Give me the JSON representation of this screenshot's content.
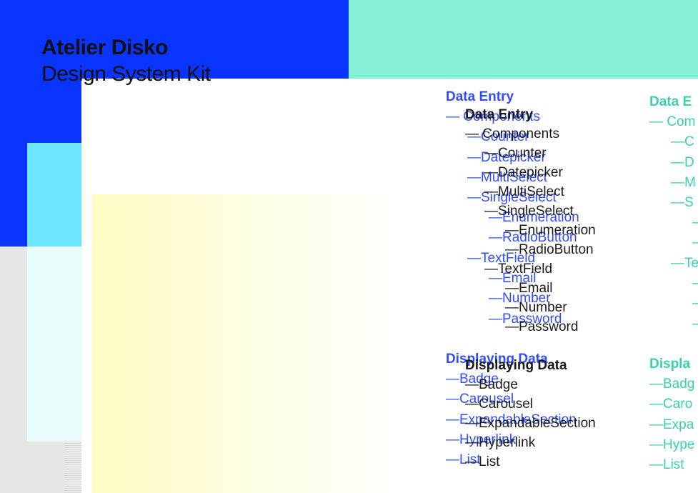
{
  "brand": {
    "title": "Atelier Disko",
    "subtitle": "Design System Kit"
  },
  "nav": {
    "data_entry": {
      "heading": "Data Entry",
      "components": "— Components",
      "counter": "—Counter",
      "datepicker": "—Datepicker",
      "multiselect": "—MultiSelect",
      "singleselect": "—SingleSelect",
      "enumeration": "—Enumeration",
      "radiobutton": "—RadioButton",
      "textfield": "—TextField",
      "email": "—Email",
      "number": "—Number",
      "password": "—Password"
    },
    "displaying_data": {
      "heading": "Displaying Data",
      "badge": "—Badge",
      "carousel": "—Carousel",
      "expandable": "—ExpandableSection",
      "hyperlink": "—Hyperlink",
      "list": "—List"
    }
  },
  "partial": {
    "heading1": "Data E",
    "components": "— Com",
    "c1": "—C",
    "c2": "—D",
    "c3": "—M",
    "c4": "—S",
    "c5": "–",
    "c6": "–",
    "c7": "—Te",
    "c8": "–",
    "c9": "–",
    "c10": "–",
    "heading2": "Displa",
    "badge": "—Badg",
    "carousel": "—Caro",
    "expandable": "—Expa",
    "hyperlink": "—Hype",
    "list": "—List"
  },
  "colors": {
    "blue_block": "#0a34ff",
    "mint_block": "#85f0d6",
    "menu_blue": "#2f4dff",
    "menu_dark": "#1a1a1a",
    "menu_teal": "#37d2a6"
  }
}
